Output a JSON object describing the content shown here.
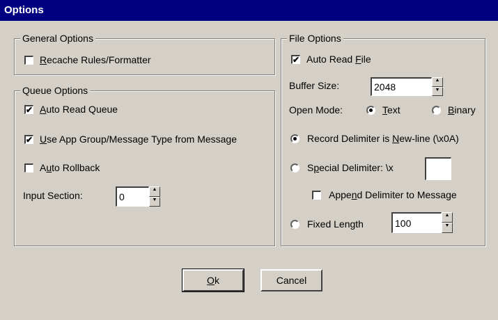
{
  "window": {
    "title": "Options"
  },
  "general": {
    "title": "General Options",
    "recache": {
      "pre": "",
      "key": "R",
      "post": "ecache Rules/Formatter",
      "checked": false
    }
  },
  "queue": {
    "title": "Queue Options",
    "auto_read": {
      "pre": "",
      "key": "A",
      "post": "uto Read Queue",
      "checked": true
    },
    "use_app_group": {
      "pre": "",
      "key": "U",
      "post": "se App Group/Message Type from Message",
      "checked": true
    },
    "auto_rollback": {
      "pre": "A",
      "key": "u",
      "post": "to Rollback",
      "checked": false
    },
    "input_section": {
      "label": "Input Section:",
      "value": "0"
    }
  },
  "file": {
    "title": "File Options",
    "auto_read_file": {
      "pre": "Auto Read ",
      "key": "F",
      "post": "ile",
      "checked": true
    },
    "buffer_size": {
      "label": "Buffer Size:",
      "value": "2048"
    },
    "open_mode": {
      "label": "Open Mode:",
      "text": {
        "pre": "",
        "key": "T",
        "post": "ext",
        "selected": true
      },
      "binary": {
        "pre": "",
        "key": "B",
        "post": "inary",
        "selected": false
      }
    },
    "record_delim": {
      "pre": "Record Delimiter is ",
      "key": "N",
      "post": "ew-line (\\x0A)",
      "selected": true
    },
    "special_delim": {
      "pre": "S",
      "key": "p",
      "post": "ecial Delimiter:  \\x",
      "selected": false,
      "value": ""
    },
    "append_delim": {
      "pre": "Appe",
      "key": "n",
      "post": "d Delimiter to Message",
      "checked": false
    },
    "fixed_length": {
      "label": "Fixed Length",
      "selected": false,
      "value": "100"
    }
  },
  "buttons": {
    "ok": {
      "pre": "",
      "key": "O",
      "post": "k"
    },
    "cancel": {
      "label": "Cancel"
    }
  }
}
